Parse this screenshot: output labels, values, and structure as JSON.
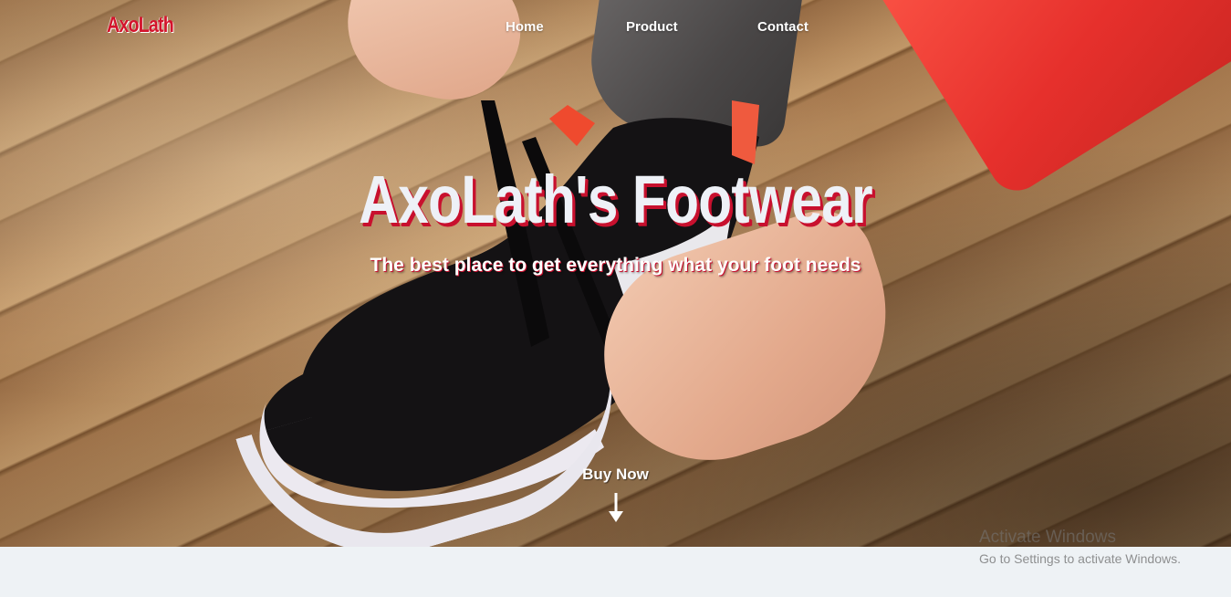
{
  "nav": {
    "logo": "AxoLath",
    "links": [
      "Home",
      "Product",
      "Contact"
    ]
  },
  "hero": {
    "title": "AxoLath's Footwear",
    "subtitle": "The best place to get everything what your foot needs",
    "cta_label": "Buy Now",
    "cta_icon": "arrow-down-icon"
  },
  "watermark": {
    "title": "Activate Windows",
    "subtitle": "Go to Settings to activate Windows."
  },
  "colors": {
    "accent": "#c8102e",
    "logo": "#d3142c",
    "page_background": "#eef2f5",
    "nav_text": "#ffffff"
  }
}
